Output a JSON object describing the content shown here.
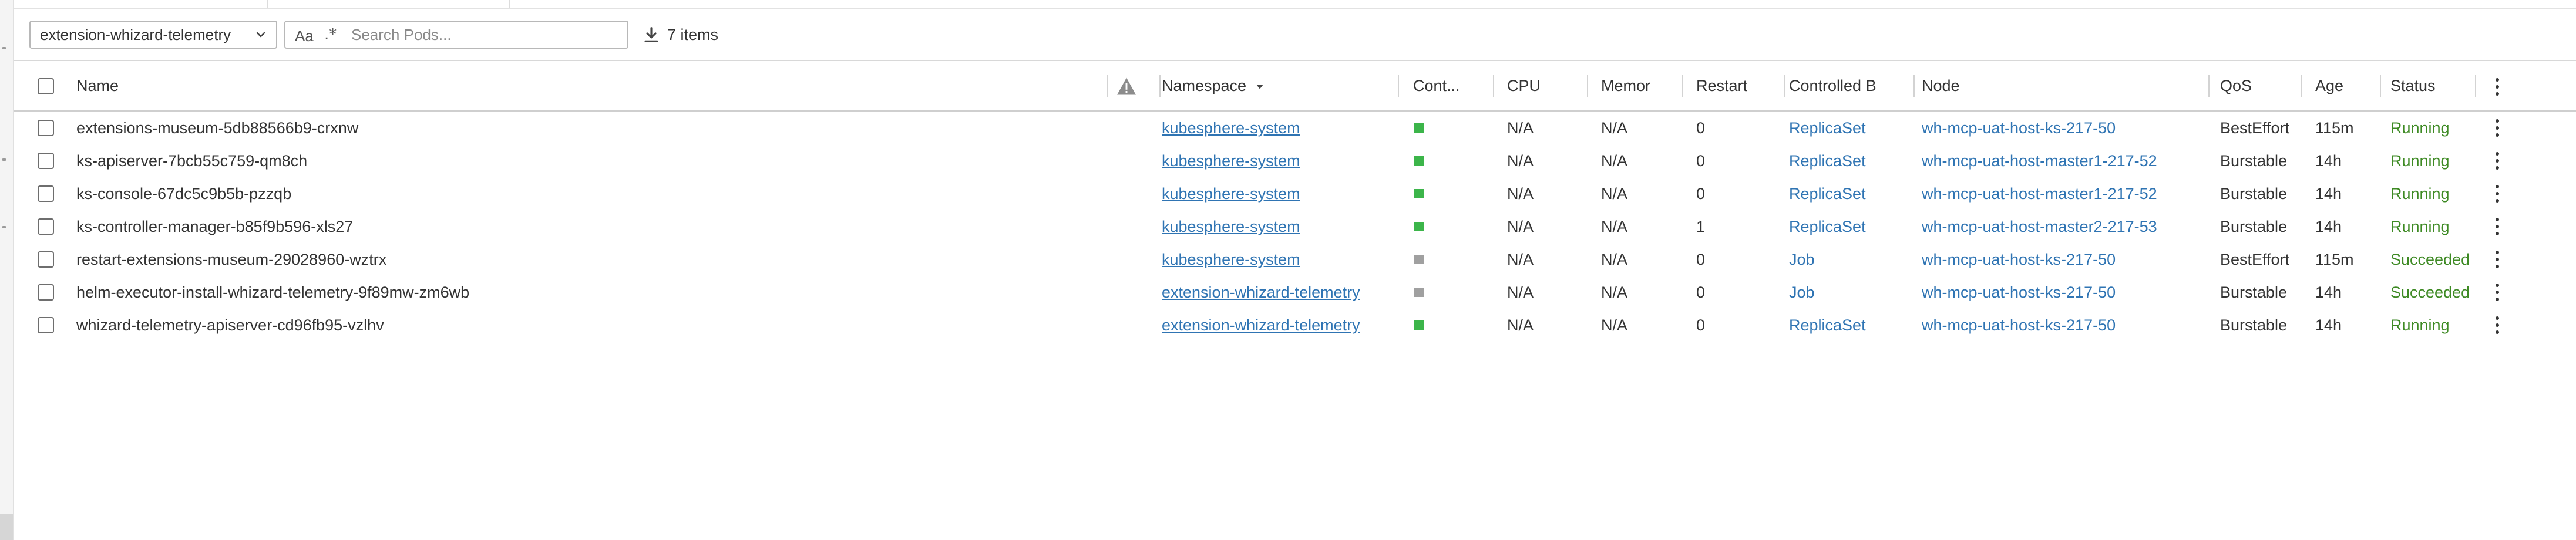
{
  "toolbar": {
    "namespace_selected": "extension-whizard-telemetry",
    "case_toggle_label": "Aa",
    "regex_toggle_label": ".*",
    "search_placeholder": "Search Pods...",
    "item_count": "7 items"
  },
  "table": {
    "headers": {
      "name": "Name",
      "namespace": "Namespace",
      "containers": "Cont...",
      "cpu": "CPU",
      "memory": "Memor",
      "restart": "Restart",
      "controlled_by": "Controlled B",
      "node": "Node",
      "qos": "QoS",
      "age": "Age",
      "status": "Status"
    },
    "rows": [
      {
        "name": "extensions-museum-5db88566b9-crxnw",
        "namespace": "kubesphere-system",
        "container_color": "#3cb54a",
        "cpu": "N/A",
        "memory": "N/A",
        "restart": "0",
        "controlled_by": "ReplicaSet",
        "node": "wh-mcp-uat-host-ks-217-50",
        "qos": "BestEffort",
        "age": "115m",
        "status": "Running",
        "status_color": "#3e8a24"
      },
      {
        "name": "ks-apiserver-7bcb55c759-qm8ch",
        "namespace": "kubesphere-system",
        "container_color": "#3cb54a",
        "cpu": "N/A",
        "memory": "N/A",
        "restart": "0",
        "controlled_by": "ReplicaSet",
        "node": "wh-mcp-uat-host-master1-217-52",
        "qos": "Burstable",
        "age": "14h",
        "status": "Running",
        "status_color": "#3e8a24"
      },
      {
        "name": "ks-console-67dc5c9b5b-pzzqb",
        "namespace": "kubesphere-system",
        "container_color": "#3cb54a",
        "cpu": "N/A",
        "memory": "N/A",
        "restart": "0",
        "controlled_by": "ReplicaSet",
        "node": "wh-mcp-uat-host-master1-217-52",
        "qos": "Burstable",
        "age": "14h",
        "status": "Running",
        "status_color": "#3e8a24"
      },
      {
        "name": "ks-controller-manager-b85f9b596-xls27",
        "namespace": "kubesphere-system",
        "container_color": "#3cb54a",
        "cpu": "N/A",
        "memory": "N/A",
        "restart": "1",
        "controlled_by": "ReplicaSet",
        "node": "wh-mcp-uat-host-master2-217-53",
        "qos": "Burstable",
        "age": "14h",
        "status": "Running",
        "status_color": "#3e8a24"
      },
      {
        "name": "restart-extensions-museum-29028960-wztrx",
        "namespace": "kubesphere-system",
        "container_color": "#a0a0a0",
        "cpu": "N/A",
        "memory": "N/A",
        "restart": "0",
        "controlled_by": "Job",
        "node": "wh-mcp-uat-host-ks-217-50",
        "qos": "BestEffort",
        "age": "115m",
        "status": "Succeeded",
        "status_color": "#3e8a24"
      },
      {
        "name": "helm-executor-install-whizard-telemetry-9f89mw-zm6wb",
        "namespace": "extension-whizard-telemetry",
        "container_color": "#a0a0a0",
        "cpu": "N/A",
        "memory": "N/A",
        "restart": "0",
        "controlled_by": "Job",
        "node": "wh-mcp-uat-host-ks-217-50",
        "qos": "Burstable",
        "age": "14h",
        "status": "Succeeded",
        "status_color": "#3e8a24"
      },
      {
        "name": "whizard-telemetry-apiserver-cd96fb95-vzlhv",
        "namespace": "extension-whizard-telemetry",
        "container_color": "#3cb54a",
        "cpu": "N/A",
        "memory": "N/A",
        "restart": "0",
        "controlled_by": "ReplicaSet",
        "node": "wh-mcp-uat-host-ks-217-50",
        "qos": "Burstable",
        "age": "14h",
        "status": "Running",
        "status_color": "#3e8a24"
      }
    ]
  }
}
